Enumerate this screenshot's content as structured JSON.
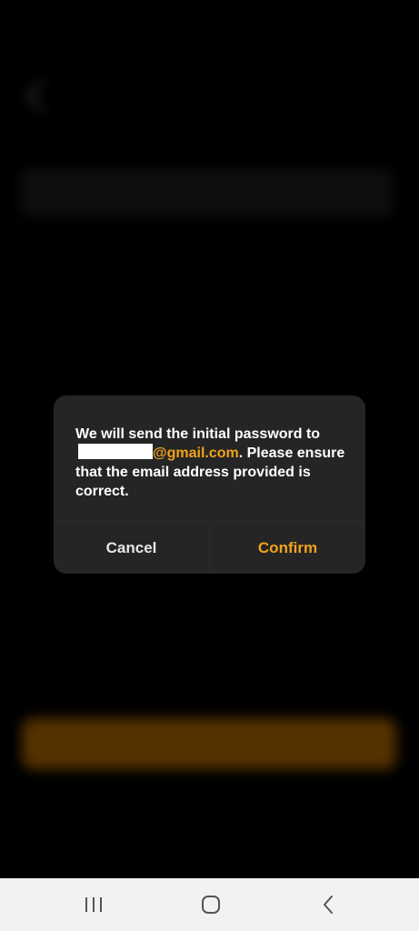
{
  "dialog": {
    "message_part1": "We will send the initial password to",
    "email_domain": "@gmail.com",
    "message_part2": ". Please ensure that the email address provided is correct.",
    "cancel_label": "Cancel",
    "confirm_label": "Confirm"
  },
  "colors": {
    "accent": "#f3a21a",
    "dialog_background": "#252525",
    "navbar_background": "#f2f2f2"
  },
  "navbar": {
    "icons": [
      "recents-icon",
      "home-icon",
      "back-icon"
    ]
  }
}
